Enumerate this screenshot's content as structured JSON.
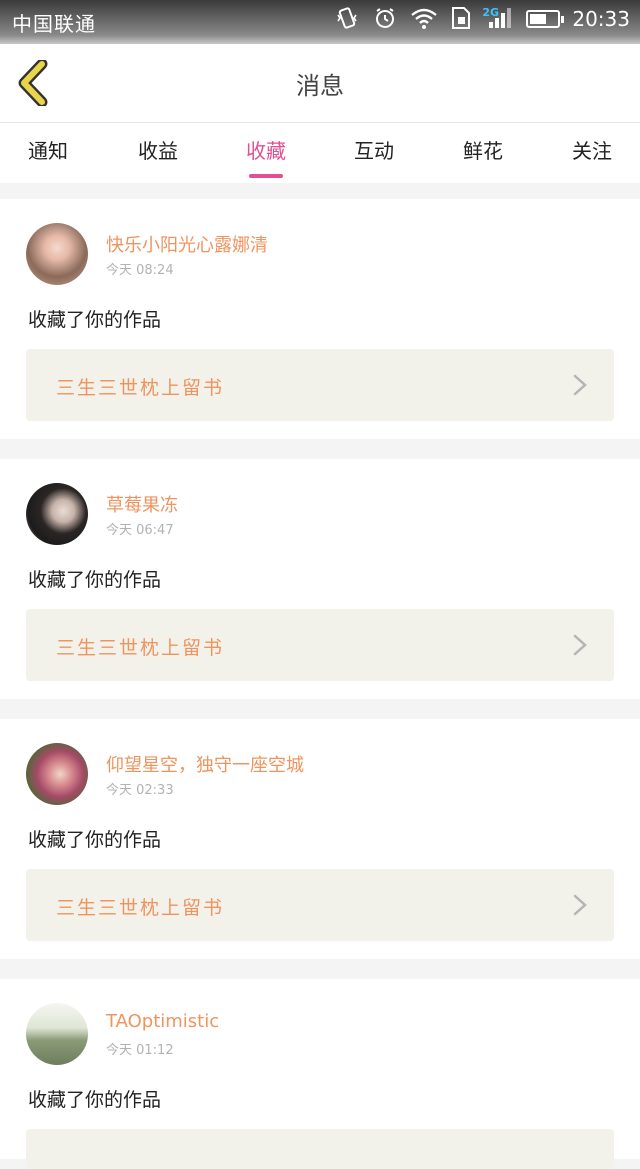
{
  "status_bar": {
    "carrier": "中国联通",
    "network_tag": "2G",
    "time": "20:33",
    "battery_level": 0.6
  },
  "header": {
    "title": "消息",
    "back_icon": "chevron-left-icon"
  },
  "tabs": [
    {
      "label": "通知",
      "active": false
    },
    {
      "label": "收益",
      "active": false
    },
    {
      "label": "收藏",
      "active": true
    },
    {
      "label": "互动",
      "active": false
    },
    {
      "label": "鲜花",
      "active": false
    },
    {
      "label": "关注",
      "active": false
    }
  ],
  "messages": [
    {
      "user": "快乐小阳光心露娜清",
      "time": "今天 08:24",
      "action": "收藏了你的作品",
      "work_title": "三生三世枕上留书",
      "avatar_colors": [
        "#c9a58e",
        "#e8cfc0"
      ]
    },
    {
      "user": "草莓果冻",
      "time": "今天 06:47",
      "action": "收藏了你的作品",
      "work_title": "三生三世枕上留书",
      "avatar_colors": [
        "#2d2a2a",
        "#d8d0cb"
      ]
    },
    {
      "user": "仰望星空，独守一座空城",
      "time": "今天 02:33",
      "action": "收藏了你的作品",
      "work_title": "三生三世枕上留书",
      "avatar_colors": [
        "#b9607a",
        "#5a8c3c"
      ]
    },
    {
      "user": "TAOptimistic",
      "time": "今天 01:12",
      "action": "收藏了你的作品",
      "work_title": "",
      "avatar_colors": [
        "#8a9a7a",
        "#dfe7d8"
      ]
    }
  ],
  "colors": {
    "accent": "#e24f93",
    "name": "#f0945f",
    "back_icon": "#e0c43a"
  }
}
